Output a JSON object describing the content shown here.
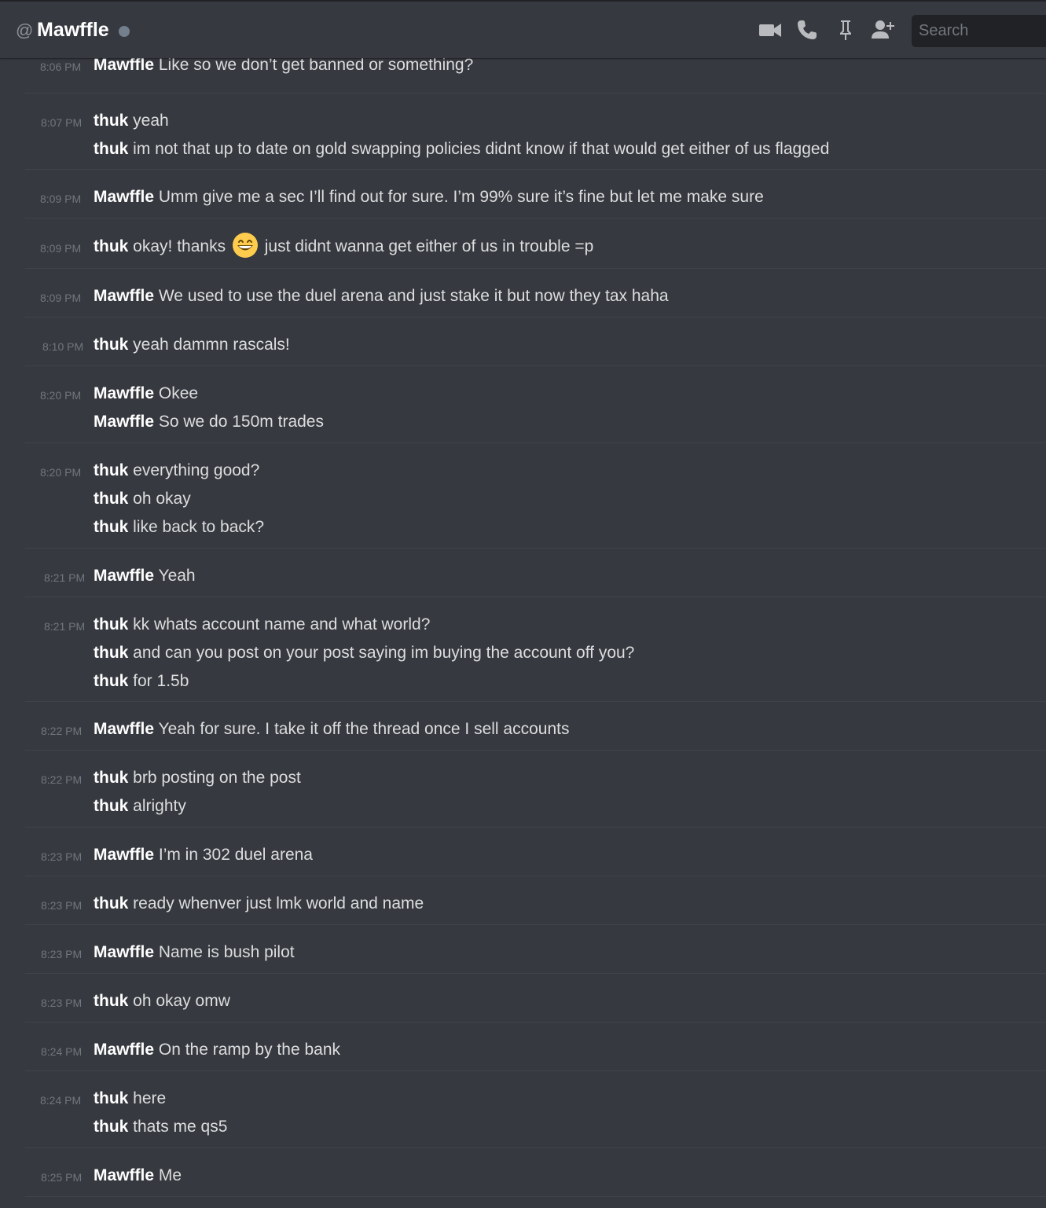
{
  "header": {
    "at_symbol": "@",
    "channel_name": "Mawffle",
    "search_placeholder": "Search"
  },
  "messages": [
    {
      "time": "8:06 PM",
      "lines": [
        {
          "author": "Mawffle",
          "text": "Like so we don’t get banned or something?"
        }
      ]
    },
    {
      "time": "8:07 PM",
      "lines": [
        {
          "author": "thuk",
          "text": "yeah"
        },
        {
          "author": "thuk",
          "text": "im not that up to date on gold swapping policies didnt know if that would get either of us flagged"
        }
      ]
    },
    {
      "time": "8:09 PM",
      "lines": [
        {
          "author": "Mawffle",
          "text": "Umm give me a sec I’ll find out for sure. I’m 99% sure it’s fine but let me make sure"
        }
      ]
    },
    {
      "time": "8:09 PM",
      "lines": [
        {
          "author": "thuk",
          "text": "okay! thanks",
          "emoji": "smile-emoji",
          "text_after": "just didnt wanna get either of us in trouble =p"
        }
      ]
    },
    {
      "time": "8:09 PM",
      "lines": [
        {
          "author": "Mawffle",
          "text": "We used to use the duel arena and just stake it but now they tax haha"
        }
      ]
    },
    {
      "time": "8:10 PM",
      "lines": [
        {
          "author": "thuk",
          "text": "yeah dammn rascals!"
        }
      ]
    },
    {
      "time": "8:20 PM",
      "lines": [
        {
          "author": "Mawffle",
          "text": "Okee"
        },
        {
          "author": "Mawffle",
          "text": "So we do 150m trades"
        }
      ]
    },
    {
      "time": "8:20 PM",
      "lines": [
        {
          "author": "thuk",
          "text": "everything good?"
        },
        {
          "author": "thuk",
          "text": "oh okay"
        },
        {
          "author": "thuk",
          "text": "like back to back?"
        }
      ]
    },
    {
      "time": "8:21 PM",
      "lines": [
        {
          "author": "Mawffle",
          "text": "Yeah"
        }
      ]
    },
    {
      "time": "8:21 PM",
      "lines": [
        {
          "author": "thuk",
          "text": "kk whats account name and what world?"
        },
        {
          "author": "thuk",
          "text": "and can you post on your post saying im buying the account off you?"
        },
        {
          "author": "thuk",
          "text": "for 1.5b"
        }
      ]
    },
    {
      "time": "8:22 PM",
      "lines": [
        {
          "author": "Mawffle",
          "text": "Yeah for sure. I take it off the thread once I sell accounts"
        }
      ]
    },
    {
      "time": "8:22 PM",
      "lines": [
        {
          "author": "thuk",
          "text": "brb posting on the post"
        },
        {
          "author": "thuk",
          "text": "alrighty"
        }
      ]
    },
    {
      "time": "8:23 PM",
      "lines": [
        {
          "author": "Mawffle",
          "text": "I’m in 302 duel arena"
        }
      ]
    },
    {
      "time": "8:23 PM",
      "lines": [
        {
          "author": "thuk",
          "text": "ready whenver just lmk world and name"
        }
      ]
    },
    {
      "time": "8:23 PM",
      "lines": [
        {
          "author": "Mawffle",
          "text": "Name is bush pilot"
        }
      ]
    },
    {
      "time": "8:23 PM",
      "lines": [
        {
          "author": "thuk",
          "text": "oh okay omw"
        }
      ]
    },
    {
      "time": "8:24 PM",
      "lines": [
        {
          "author": "Mawffle",
          "text": "On the ramp by the bank"
        }
      ]
    },
    {
      "time": "8:24 PM",
      "lines": [
        {
          "author": "thuk",
          "text": "here"
        },
        {
          "author": "thuk",
          "text": "thats me qs5"
        }
      ]
    },
    {
      "time": "8:25 PM",
      "lines": [
        {
          "author": "Mawffle",
          "text": "Me"
        }
      ]
    }
  ]
}
